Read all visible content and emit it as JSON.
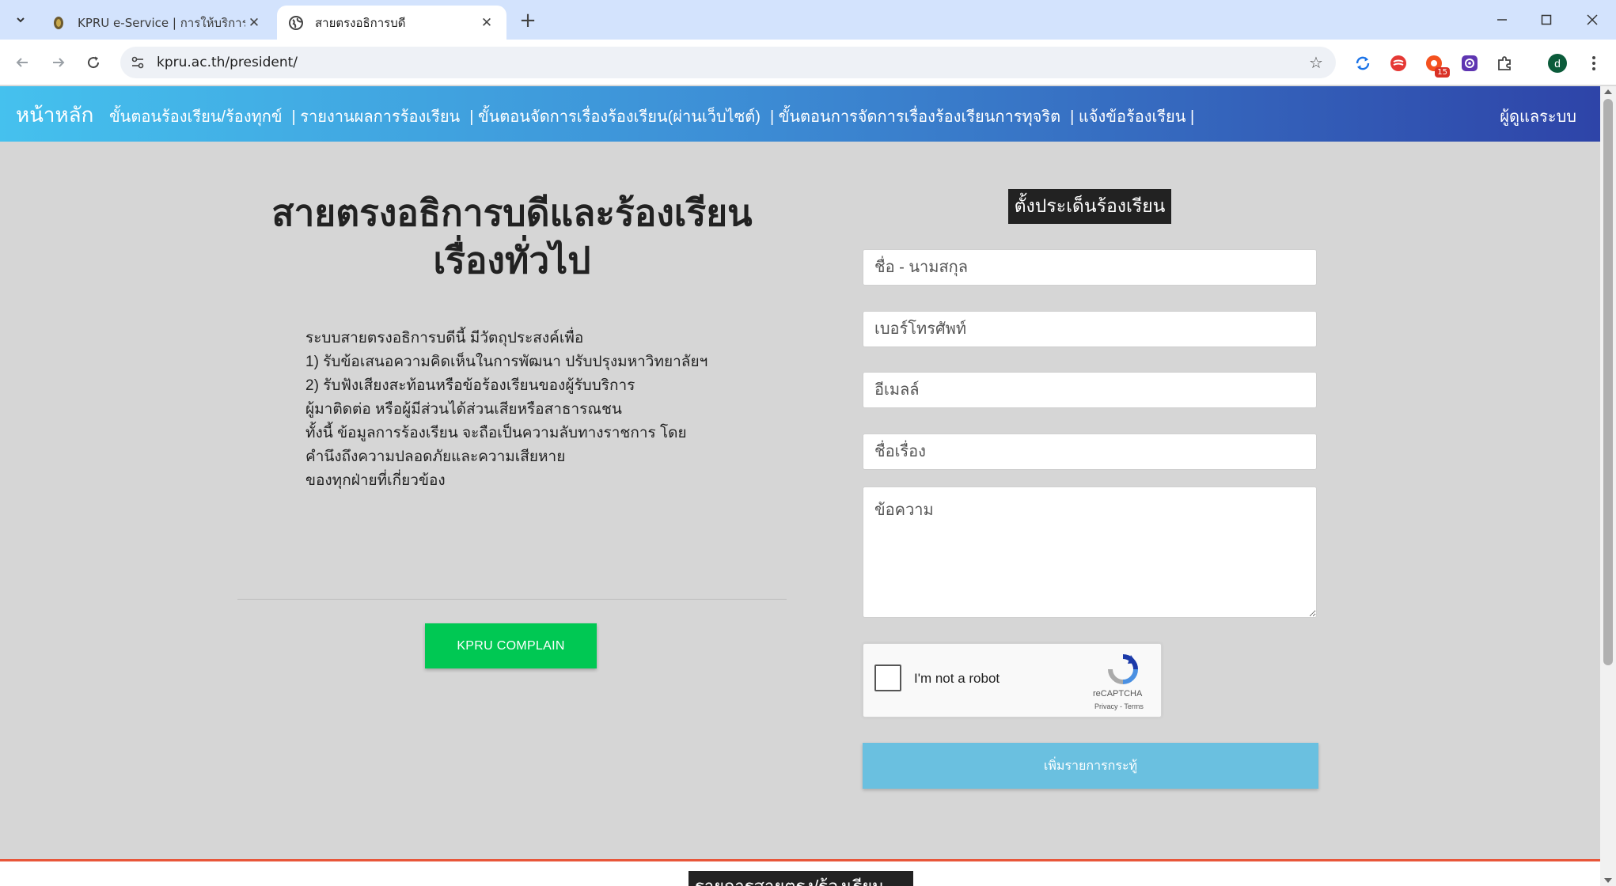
{
  "browser": {
    "tabs": [
      {
        "title": "KPRU e-Service | การให้บริการออนไลน์",
        "active": false
      },
      {
        "title": "สายตรงอธิการบดี",
        "active": true
      }
    ],
    "new_tab_symbol": "+",
    "address_bar": {
      "url": "kpru.ac.th/president/"
    },
    "extensions": [
      {
        "icon": "sync-icon",
        "color": "#1a73e8"
      },
      {
        "icon": "red-extension-icon",
        "color": "#e53935"
      },
      {
        "icon": "notification-extension-icon",
        "color": "#f4511e",
        "badge": "15"
      },
      {
        "icon": "purple-extension-icon",
        "color": "#5e35b1"
      },
      {
        "icon": "puzzle-icon",
        "color": "#444444"
      }
    ],
    "profile_initial": "d",
    "profile_color": "#0b5b3a"
  },
  "navbar": {
    "brand": "หน้าหลัก",
    "links": [
      "ขั้นตอนร้องเรียน/ร้องทุกข์",
      "| รายงานผลการร้องเรียน",
      "| ขั้นตอนจัดการเรื่องร้องเรียน(ผ่านเว็บไซต์)",
      "| ขั้นตอนการจัดการเรื่องร้องเรียนการทุจริต",
      "| แจ้งข้อร้องเรียน |"
    ],
    "admin_link": "ผู้ดูแลระบบ",
    "gradient": [
      "#45c1ee",
      "#3d8fd6",
      "#2e44a8"
    ]
  },
  "left": {
    "title_line1": "สายตรงอธิการบดีและร้องเรียน",
    "title_line2": "เรื่องทั่วไป",
    "description": [
      "ระบบสายตรงอธิการบดีนี้ มีวัตถุประสงค์เพื่อ",
      "1) รับข้อเสนอความคิดเห็นในการพัฒนา ปรับปรุงมหาวิทยาลัยฯ",
      "2) รับฟังเสียงสะท้อนหรือข้อร้องเรียนของผู้รับบริการ",
      "ผู้มาติดต่อ หรือผู้มีส่วนได้ส่วนเสียหรือสาธารณชน",
      "ทั้งนี้ ข้อมูลการร้องเรียน จะถือเป็นความลับทางราชการ โดย",
      "คำนึงถึงความปลอดภัยและความเสียหาย",
      "ของทุกฝ่ายที่เกี่ยวข้อง"
    ],
    "complain_button": "KPRU COMPLAIN",
    "complain_button_color": "#00c853"
  },
  "form": {
    "title": "ตั้งประเด็นร้องเรียน",
    "name_placeholder": "ชื่อ - นามสกุล",
    "phone_placeholder": "เบอร์โทรศัพท์",
    "email_placeholder": "อีเมลล์",
    "subject_placeholder": "ชื่อเรื่อง",
    "message_placeholder": "ข้อความ",
    "recaptcha": {
      "label": "I'm not a robot",
      "brand": "reCAPTCHA",
      "links": "Privacy - Terms"
    },
    "submit_button": "เพิ่มรายการกระทู้",
    "submit_button_color": "#6ac0e0"
  },
  "footer": {
    "title": "รายการสายตรง/ร้องเรียน",
    "accent_color": "#e8563a"
  }
}
